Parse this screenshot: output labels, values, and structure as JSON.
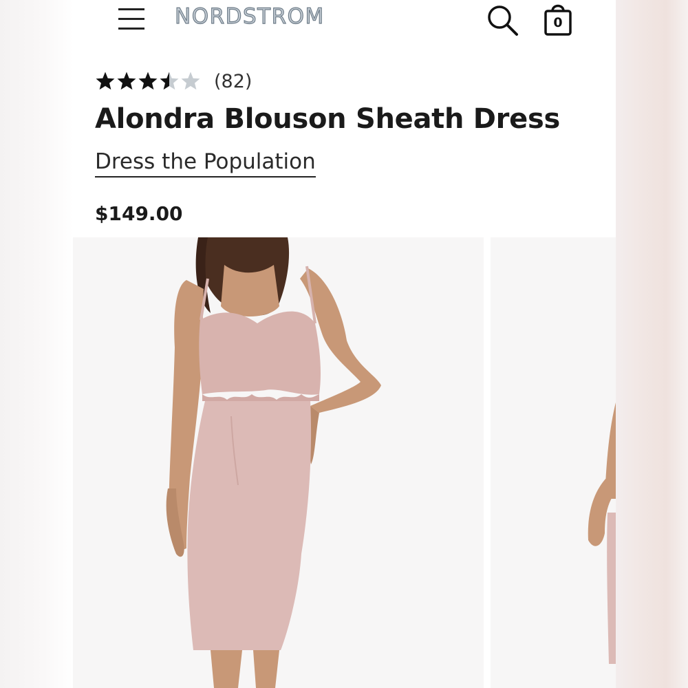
{
  "header": {
    "brand": "NORDSTROM",
    "menu_icon": "hamburger-menu-icon",
    "search_icon": "search-icon",
    "bag_icon": "shopping-bag-icon",
    "bag_count": "0"
  },
  "product": {
    "rating": 3.5,
    "rating_max": 5,
    "review_count": "(82)",
    "title": "Alondra Blouson Sheath Dress",
    "brand": "Dress the Population",
    "price": "$149.00"
  },
  "gallery": {
    "images": [
      "model-wearing-blush-dress-front",
      "model-wearing-blush-dress-side"
    ]
  },
  "colors": {
    "dress": "#dcbab6",
    "skin": "#c89877",
    "hair": "#4a2e20",
    "star_filled": "#111111",
    "star_empty": "#c6ccd1"
  }
}
